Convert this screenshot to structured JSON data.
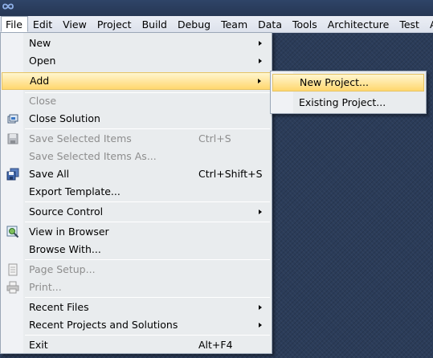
{
  "app": {
    "logo_icon": "vs-infinity-logo-icon"
  },
  "menubar": {
    "items": [
      {
        "label": "File"
      },
      {
        "label": "Edit"
      },
      {
        "label": "View"
      },
      {
        "label": "Project"
      },
      {
        "label": "Build"
      },
      {
        "label": "Debug"
      },
      {
        "label": "Team"
      },
      {
        "label": "Data"
      },
      {
        "label": "Tools"
      },
      {
        "label": "Architecture"
      },
      {
        "label": "Test"
      },
      {
        "label": "Ana"
      }
    ],
    "active": "File"
  },
  "file_menu": {
    "items": [
      {
        "label": "New",
        "submenu": true
      },
      {
        "label": "Open",
        "submenu": true
      },
      {
        "label": "Add",
        "submenu": true,
        "highlighted": true
      },
      {
        "label": "Close",
        "disabled": true
      },
      {
        "label": "Close Solution",
        "icon": "close-solution-icon"
      },
      {
        "label": "Save Selected Items",
        "shortcut": "Ctrl+S",
        "disabled": true,
        "icon": "save-icon"
      },
      {
        "label": "Save Selected Items As...",
        "disabled": true
      },
      {
        "label": "Save All",
        "shortcut": "Ctrl+Shift+S",
        "icon": "save-all-icon"
      },
      {
        "label": "Export Template..."
      },
      {
        "label": "Source Control",
        "submenu": true
      },
      {
        "label": "View in Browser",
        "icon": "view-in-browser-icon"
      },
      {
        "label": "Browse With..."
      },
      {
        "label": "Page Setup...",
        "disabled": true,
        "icon": "page-setup-icon"
      },
      {
        "label": "Print...",
        "disabled": true,
        "icon": "print-icon"
      },
      {
        "label": "Recent Files",
        "submenu": true
      },
      {
        "label": "Recent Projects and Solutions",
        "submenu": true
      },
      {
        "label": "Exit",
        "shortcut": "Alt+F4"
      }
    ]
  },
  "add_submenu": {
    "items": [
      {
        "label": "New Project...",
        "highlighted": true
      },
      {
        "label": "Existing Project..."
      }
    ]
  },
  "colors": {
    "workspace": "#2b3c59",
    "menu_background": "#e9ecee",
    "highlight": "#ffe59a",
    "highlight_border": "#e5c365",
    "disabled_text": "#8d8d8d"
  }
}
